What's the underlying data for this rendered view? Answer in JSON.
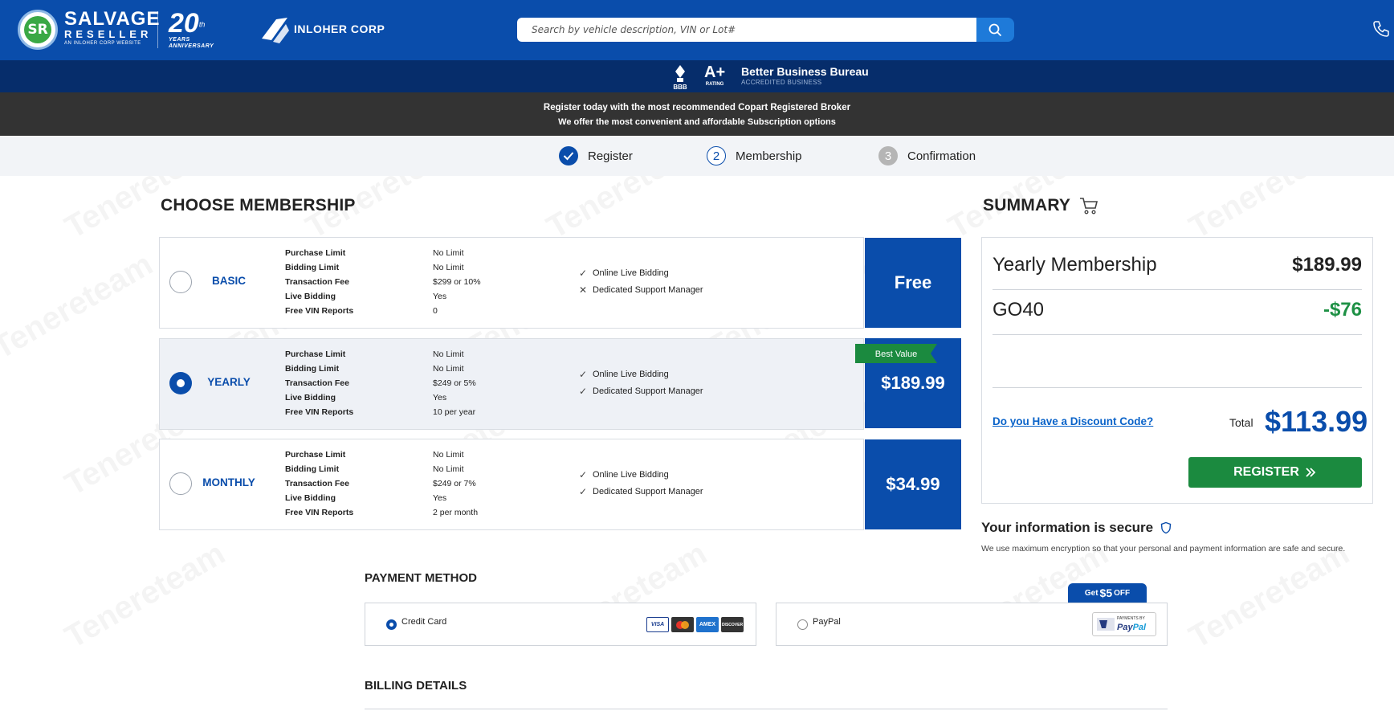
{
  "header": {
    "logo_initials": "SR",
    "logo_line1": "SALVAGE",
    "logo_line2": "RESELLER",
    "logo_line3": "AN INLOHER CORP WEBSITE",
    "anniversary_number": "20",
    "anniversary_suffix": "th",
    "anniversary_years": "YEARS",
    "anniversary_label": "ANNIVERSARY",
    "partner_name": "INLOHER CORP",
    "search_placeholder": "Search by vehicle description, VIN or Lot#",
    "search_icon": "search-icon",
    "phone_icon": "phone-icon",
    "colors": {
      "primary": "#0a4dab",
      "dark": "#062d6b",
      "accent_green": "#1b8a3f",
      "discount_green": "#1e9145"
    }
  },
  "bbb": {
    "logo_text": "BBB",
    "rating": "A+",
    "rating_label": "RATING",
    "title": "Better Business Bureau",
    "subtitle": "ACCREDITED BUSINESS"
  },
  "promo": {
    "line1": "Register today with the most recommended Copart Registered Broker",
    "line2": "We offer the most convenient and affordable Subscription options"
  },
  "steps": [
    {
      "label": "Register",
      "marker": "",
      "state": "done"
    },
    {
      "label": "Membership",
      "marker": "2",
      "state": "active"
    },
    {
      "label": "Confirmation",
      "marker": "3",
      "state": "pending"
    }
  ],
  "membership": {
    "title": "CHOOSE MEMBERSHIP",
    "best_value_label": "Best Value",
    "plans": [
      {
        "name": "BASIC",
        "selected": false,
        "price": "Free",
        "features": [
          {
            "key": "Purchase Limit",
            "value": "No Limit"
          },
          {
            "key": "Bidding Limit",
            "value": "No Limit"
          },
          {
            "key": "Transaction Fee",
            "value": "$299 or 10%"
          },
          {
            "key": "Live Bidding",
            "value": "Yes"
          },
          {
            "key": "Free VIN Reports",
            "value": "0"
          }
        ],
        "checks": [
          {
            "mark": "✓",
            "label": "Online Live Bidding"
          },
          {
            "mark": "✕",
            "label": "Dedicated Support Manager"
          }
        ]
      },
      {
        "name": "YEARLY",
        "selected": true,
        "price": "$189.99",
        "features": [
          {
            "key": "Purchase Limit",
            "value": "No Limit"
          },
          {
            "key": "Bidding Limit",
            "value": "No Limit"
          },
          {
            "key": "Transaction Fee",
            "value": "$249 or 5%"
          },
          {
            "key": "Live Bidding",
            "value": "Yes"
          },
          {
            "key": "Free VIN Reports",
            "value": "10 per year"
          }
        ],
        "checks": [
          {
            "mark": "✓",
            "label": "Online Live Bidding"
          },
          {
            "mark": "✓",
            "label": "Dedicated Support Manager"
          }
        ]
      },
      {
        "name": "MONTHLY",
        "selected": false,
        "price": "$34.99",
        "features": [
          {
            "key": "Purchase Limit",
            "value": "No Limit"
          },
          {
            "key": "Bidding Limit",
            "value": "No Limit"
          },
          {
            "key": "Transaction Fee",
            "value": "$249 or 7%"
          },
          {
            "key": "Live Bidding",
            "value": "Yes"
          },
          {
            "key": "Free VIN Reports",
            "value": "2 per month"
          }
        ],
        "checks": [
          {
            "mark": "✓",
            "label": "Online Live Bidding"
          },
          {
            "mark": "✓",
            "label": "Dedicated Support Manager"
          }
        ]
      }
    ]
  },
  "summary": {
    "title": "SUMMARY",
    "cart_icon": "cart-icon",
    "item_label": "Yearly Membership",
    "item_price": "$189.99",
    "coupon_code": "GO40",
    "coupon_discount": "-$76",
    "discount_link": "Do you Have a Discount Code?",
    "total_label": "Total",
    "total_amount": "$113.99",
    "register_label": "REGISTER",
    "secure_title": "Your information is secure",
    "secure_text": "We use maximum encryption so that your personal and payment information are safe and secure."
  },
  "payment": {
    "title": "PAYMENT METHOD",
    "options": [
      {
        "label": "Credit Card",
        "selected": true,
        "cards": [
          "VISA",
          "MC",
          "AMEX",
          "DISCOVER"
        ]
      },
      {
        "label": "PayPal",
        "selected": false
      }
    ],
    "promo_prefix": "Get",
    "promo_amount": "$5",
    "promo_suffix": "OFF",
    "paypal_badge_top": "PAYMENTS BY",
    "paypal_badge_pay": "Pay",
    "paypal_badge_pal": "Pal"
  },
  "billing": {
    "title": "BILLING DETAILS"
  },
  "watermark_text": "Tenereteam"
}
